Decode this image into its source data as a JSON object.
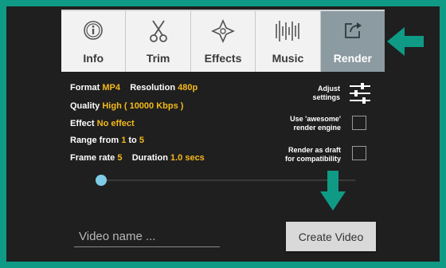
{
  "tabs": [
    {
      "label": "Info",
      "icon": "info-icon"
    },
    {
      "label": "Trim",
      "icon": "scissors-icon"
    },
    {
      "label": "Effects",
      "icon": "effects-icon"
    },
    {
      "label": "Music",
      "icon": "music-waveform-icon"
    },
    {
      "label": "Render",
      "icon": "export-icon",
      "active": true
    }
  ],
  "settings": {
    "format_label": "Format",
    "format_value": "MP4",
    "resolution_label": "Resolution",
    "resolution_value": "480p",
    "quality_label": "Quality",
    "quality_value": "High ( 10000 Kbps )",
    "effect_label": "Effect",
    "effect_value": "No effect",
    "range_label": "Range from",
    "range_from": "1",
    "range_to_label": "to",
    "range_to": "5",
    "framerate_label": "Frame rate",
    "framerate_value": "5",
    "duration_label": "Duration",
    "duration_value": "1.0 secs"
  },
  "options": {
    "adjust_line1": "Adjust",
    "adjust_line2": "settings",
    "awesome_line1": "Use 'awesome'",
    "awesome_line2": "render engine",
    "draft_line1": "Render as draft",
    "draft_line2": "for compatibility"
  },
  "video_name": {
    "placeholder": "Video name ..."
  },
  "create_button": "Create Video",
  "colors": {
    "accent": "#f3b91a",
    "background": "#1f1f1f",
    "border": "#0f9a86",
    "active_tab": "#8c9ba1",
    "slider": "#7ecbe8"
  }
}
